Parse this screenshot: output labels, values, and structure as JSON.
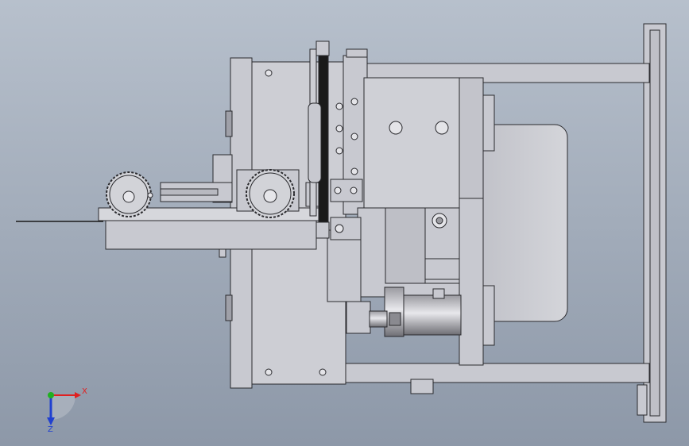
{
  "viewport": {
    "background_top": "#b7c0cc",
    "background_bottom": "#8d98a8"
  },
  "colors": {
    "part_fill": "#c8c9d0",
    "part_light": "#d8d9de",
    "part_dark": "#a9aab2",
    "edge": "#2a2a2e",
    "belt": "#1a1a1a",
    "axis_x": "#e02020",
    "axis_y": "#20b020",
    "axis_z": "#2040d0"
  },
  "triad": {
    "x_label": "X",
    "z_label": "Z"
  }
}
